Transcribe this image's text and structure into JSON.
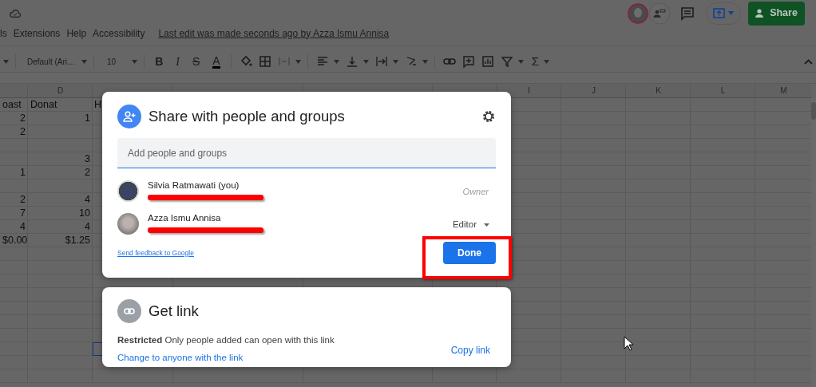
{
  "app": {
    "menu": [
      "ls",
      "Extensions",
      "Help",
      "Accessibility"
    ],
    "last_edit": "Last edit was made seconds ago by Azza Ismu Annisa",
    "share_button": "Share"
  },
  "toolbar": {
    "font": "Default (Ari…",
    "font_size": "10",
    "bold": "B",
    "italic": "I",
    "strike": "S",
    "text_color": "A",
    "sum": "Σ"
  },
  "sheet": {
    "columns": [
      {
        "label": "D"
      },
      {},
      {},
      {},
      {},
      {
        "label": "I"
      },
      {
        "label": "J"
      },
      {
        "label": "K"
      },
      {
        "label": "L"
      },
      {
        "label": "M"
      }
    ],
    "header_row": {
      "column_c": "oast",
      "column_d": "Donat",
      "column_e": "H"
    },
    "rows": [
      {
        "column_c": "2",
        "column_d": "1",
        "e_selected": false
      },
      {
        "column_c": "2",
        "e_selected": false
      },
      {
        "e_selected": false
      },
      {
        "column_d": "3",
        "e_selected": false
      },
      {
        "column_c": "1",
        "column_d": "2",
        "e_selected": false
      },
      {
        "e_selected": false
      },
      {
        "column_c": "2",
        "column_d": "4",
        "e_selected": false
      },
      {
        "column_c": "7",
        "column_d": "10",
        "e_selected": false
      },
      {
        "column_c": "4",
        "column_d": "4",
        "e_selected": false
      },
      {
        "column_c": "$0.00",
        "column_d": "$1.25",
        "e_selected": false
      },
      {
        "e_selected": false
      },
      {
        "e_selected": false
      },
      {
        "e_selected": false
      },
      {
        "e_selected": false
      },
      {
        "e_selected": false
      },
      {
        "e_selected": false
      },
      {
        "e_selected": false
      },
      {
        "e_selected": true
      },
      {
        "e_selected": false
      },
      {
        "e_selected": false
      }
    ]
  },
  "share_dialog": {
    "title": "Share with people and groups",
    "input_placeholder": "Add people and groups",
    "people": [
      {
        "name": "Silvia Ratmawati (you)",
        "role": "Owner",
        "kind": "owner",
        "email_redacted": true
      },
      {
        "name": "Azza Ismu Annisa",
        "role": "Editor",
        "kind": "editor",
        "email_redacted": true
      }
    ],
    "feedback_link": "Send feedback to Google",
    "done_button": "Done",
    "done_highlighted": true
  },
  "link_dialog": {
    "title": "Get link",
    "description": "**Restricted** Only people added can open with this link",
    "change_link": "Change to anyone with the link",
    "copy_button": "Copy link"
  }
}
